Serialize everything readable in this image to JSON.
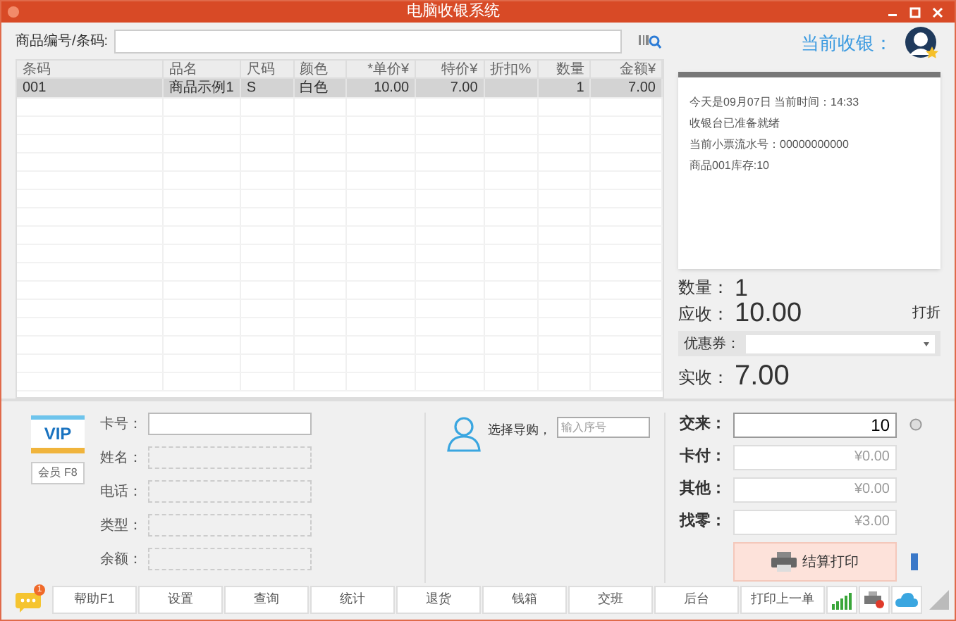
{
  "window": {
    "title": "电脑收银系统"
  },
  "search": {
    "label": "商品编号/条码:"
  },
  "table": {
    "columns": [
      "条码",
      "品名",
      "尺码",
      "颜色",
      "*单价¥",
      "特价¥",
      "折扣%",
      "数量",
      "金额¥"
    ],
    "rows": [
      {
        "selected": true,
        "cells": [
          "001",
          "商品示例1",
          "S",
          "白色",
          "10.00",
          "7.00",
          null,
          "1",
          "7.00"
        ]
      }
    ]
  },
  "cashier": {
    "label": "当前收银："
  },
  "receipt": {
    "lines": [
      "今天是09月07日 当前时间：14:33",
      "收银台已准备就绪",
      "当前小票流水号：00000000000",
      "商品001库存:10"
    ]
  },
  "summary": {
    "quantity_label": "数量：",
    "quantity": "1",
    "receivable_label": "应收：",
    "receivable": "10.00",
    "discount_button": "打折",
    "coupon_label": "优惠券：",
    "paid_label": "实收：",
    "paid": "7.00"
  },
  "member": {
    "badge": "VIP",
    "button": "会员 F8",
    "fields": [
      {
        "label": "卡号：",
        "kind": "input"
      },
      {
        "label": "姓名：",
        "kind": "readonly"
      },
      {
        "label": "电话：",
        "kind": "readonly"
      },
      {
        "label": "类型：",
        "kind": "readonly"
      },
      {
        "label": "余额：",
        "kind": "readonly"
      }
    ]
  },
  "guide": {
    "label": "选择导购，",
    "placeholder": "输入序号"
  },
  "payment": {
    "rows": [
      {
        "label": "交来：",
        "value": "10",
        "editable": true
      },
      {
        "label": "卡付：",
        "value": "¥0.00",
        "editable": false
      },
      {
        "label": "其他：",
        "value": "¥0.00",
        "editable": false
      },
      {
        "label": "找零：",
        "value": "¥3.00",
        "editable": false
      }
    ],
    "print_button": "结算打印"
  },
  "toolbar": {
    "badge": "1",
    "buttons": [
      "帮助F1",
      "设置",
      "查询",
      "统计",
      "退货",
      "钱箱",
      "交班",
      "后台",
      "打印上一单"
    ]
  }
}
